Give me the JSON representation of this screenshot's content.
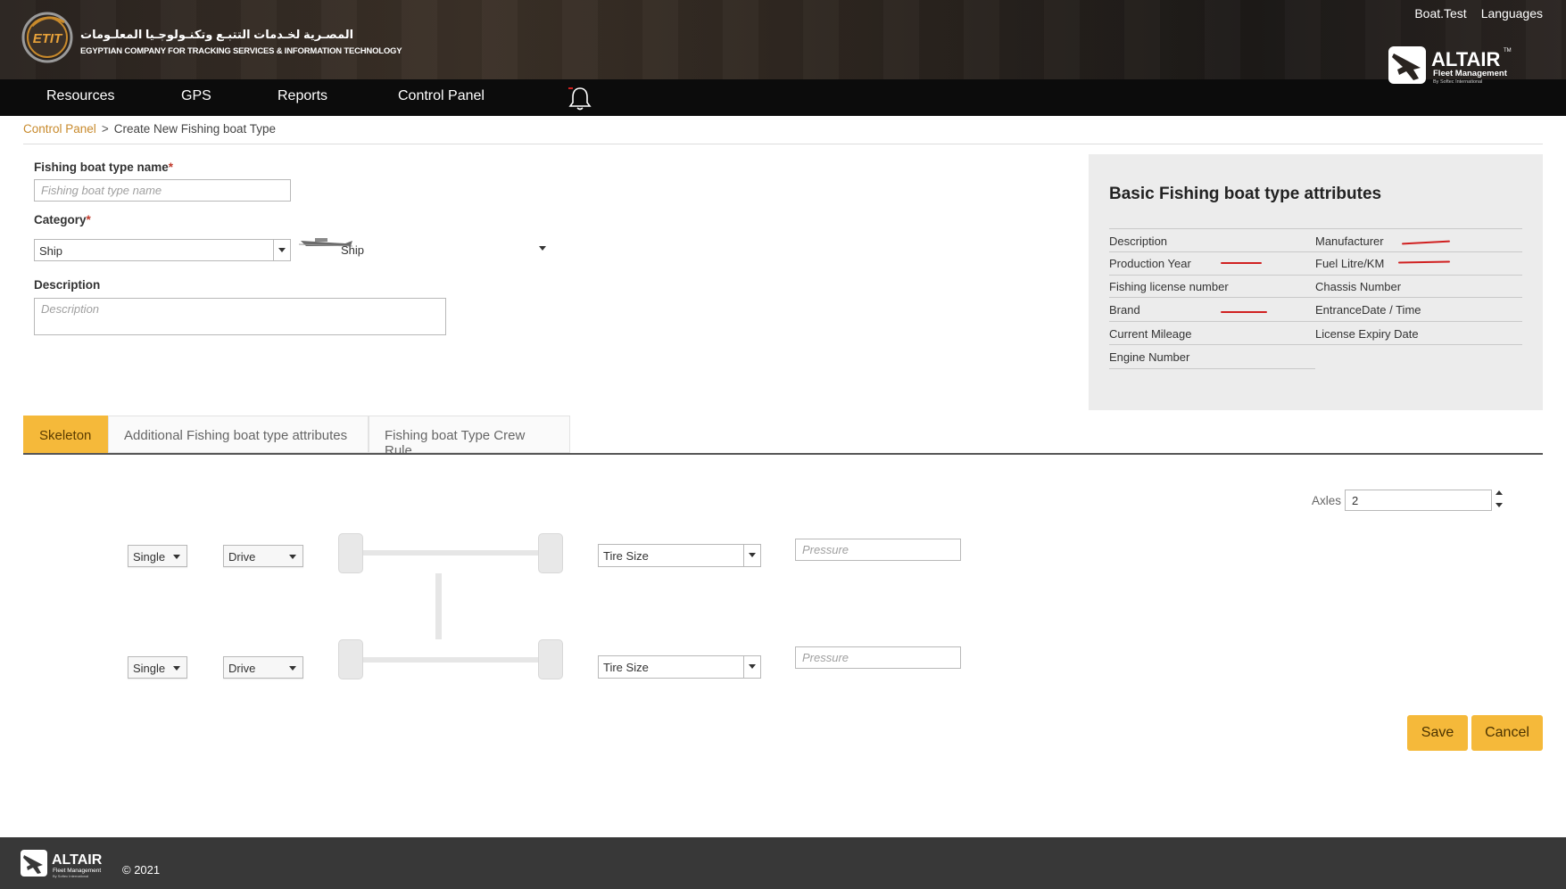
{
  "header": {
    "company_ar": "المصـرية لخـدمات التتبـع وتكنـولوجـيا المعلـومات",
    "company_en": "EGYPTIAN COMPANY FOR TRACKING SERVICES & INFORMATION TECHNOLOGY",
    "logo_text": "ETIT",
    "user": "Boat.Test",
    "languages": "Languages",
    "brand_name": "ALTAIR",
    "brand_tm": "TM",
    "brand_sub": "Fleet Management",
    "brand_sub2": "By Softec International"
  },
  "nav": {
    "items": [
      "Resources",
      "GPS",
      "Reports",
      "Control Panel"
    ],
    "bell_icon": "bell-icon"
  },
  "breadcrumb": {
    "root": "Control Panel",
    "separator": ">",
    "current": "Create New Fishing boat Type"
  },
  "form": {
    "name_label": "Fishing boat type name",
    "name_placeholder": "Fishing boat type name",
    "required_mark": "*",
    "category_label": "Category",
    "category_value": "Ship",
    "category_icon_label": "Ship",
    "description_label": "Description",
    "description_placeholder": "Description"
  },
  "attributes": {
    "title": "Basic Fishing boat type attributes",
    "left": [
      "Description",
      "Production Year",
      "Fishing license number",
      "Brand",
      "Current Mileage",
      "Engine Number"
    ],
    "right": [
      "Manufacturer",
      "Fuel Litre/KM",
      "Chassis Number",
      "EntranceDate / Time",
      "License Expiry Date"
    ]
  },
  "tabs": [
    "Skeleton",
    "Additional Fishing boat type attributes",
    "Fishing boat Type Crew Rule"
  ],
  "skeleton": {
    "axles_label": "Axles",
    "axles_value": "2",
    "rows": [
      {
        "type": "Single",
        "drive": "Drive",
        "tire": "Tire Size",
        "pressure_placeholder": "Pressure"
      },
      {
        "type": "Single",
        "drive": "Drive",
        "tire": "Tire Size",
        "pressure_placeholder": "Pressure"
      }
    ]
  },
  "actions": {
    "save": "Save",
    "cancel": "Cancel"
  },
  "footer": {
    "copyright": "© 2021"
  },
  "colors": {
    "accent": "#f5b93a",
    "link": "#c88a2c",
    "nav_bg": "#0c0c0c",
    "footer_bg": "#383838",
    "panel_bg": "#ececec"
  }
}
